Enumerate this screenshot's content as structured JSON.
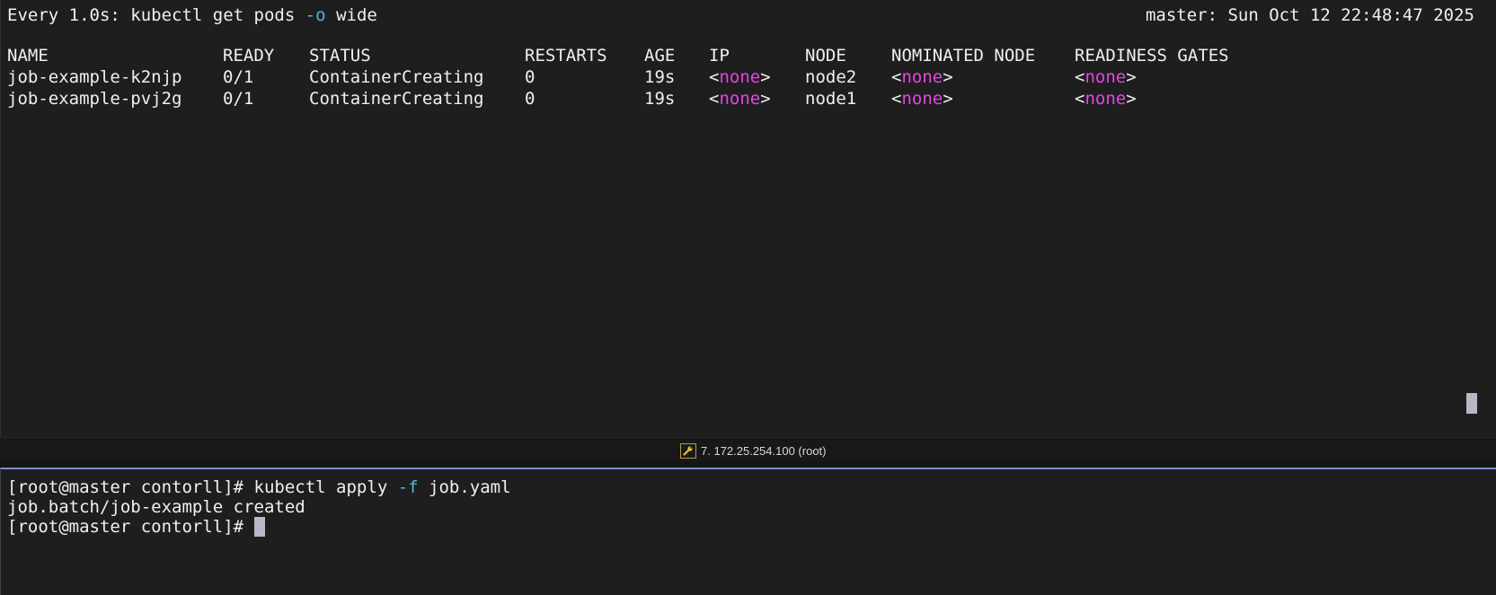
{
  "top_pane": {
    "watch_header": {
      "prefix": "Every 1.0s: kubectl get pods ",
      "flag": "-o",
      "suffix": " wide",
      "host_clock": "master: Sun Oct 12 22:48:47 2025"
    },
    "columns": [
      "NAME",
      "READY",
      "STATUS",
      "RESTARTS",
      "AGE",
      "IP",
      "NODE",
      "NOMINATED NODE",
      "READINESS GATES"
    ],
    "rows": [
      {
        "name": "job-example-k2njp",
        "ready": "0/1",
        "status": "ContainerCreating",
        "restarts": "0",
        "age": "19s",
        "ip": "none",
        "node": "node2",
        "nominated_node": "none",
        "readiness_gates": "none"
      },
      {
        "name": "job-example-pvj2g",
        "ready": "0/1",
        "status": "ContainerCreating",
        "restarts": "0",
        "age": "19s",
        "ip": "none",
        "node": "node1",
        "nominated_node": "none",
        "readiness_gates": "none"
      }
    ]
  },
  "tab_bar": {
    "tab_label": "7. 172.25.254.100 (root)",
    "tab_icon": "wrench-icon",
    "icon_color": "#f0c040"
  },
  "bottom_pane": {
    "line1_prompt": "[root@master contorll]# ",
    "line1_cmd": "kubectl apply ",
    "line1_flag": "-f",
    "line1_arg": " job.yaml",
    "line2": "job.batch/job-example created",
    "line3_prompt": "[root@master contorll]# "
  },
  "colors": {
    "background": "#1e1e1e",
    "text": "#f0f0f0",
    "flag": "#4fb8d8",
    "none_value": "#e544e5",
    "pane_divider": "#7f8fd0"
  },
  "angle_open": "<",
  "angle_close": ">"
}
